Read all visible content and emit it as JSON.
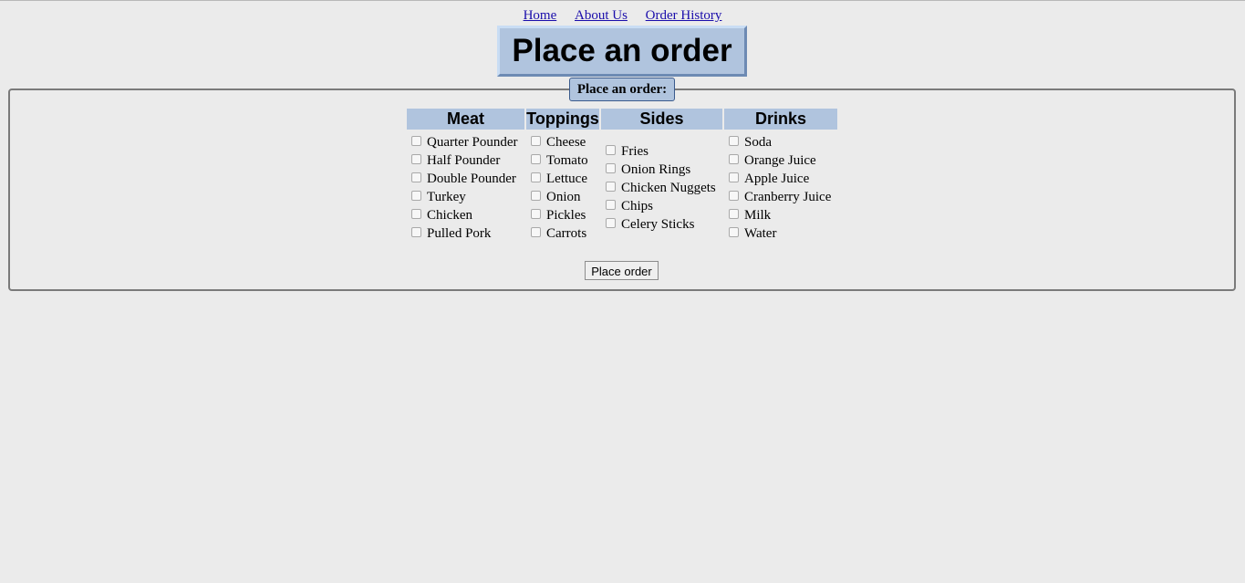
{
  "nav": {
    "links": [
      "Home",
      "About Us",
      "Order History"
    ]
  },
  "page_title": "Place an order",
  "form": {
    "legend": "Place an order:",
    "columns": [
      {
        "heading": "Meat",
        "items": [
          "Quarter Pounder",
          "Half Pounder",
          "Double Pounder",
          "Turkey",
          "Chicken",
          "Pulled Pork"
        ]
      },
      {
        "heading": "Toppings",
        "items": [
          "Cheese",
          "Tomato",
          "Lettuce",
          "Onion",
          "Pickles",
          "Carrots"
        ]
      },
      {
        "heading": "Sides",
        "items": [
          "Fries",
          "Onion Rings",
          "Chicken Nuggets",
          "Chips",
          "Celery Sticks"
        ]
      },
      {
        "heading": "Drinks",
        "items": [
          "Soda",
          "Orange Juice",
          "Apple Juice",
          "Cranberry Juice",
          "Milk",
          "Water"
        ]
      }
    ],
    "submit_label": "Place order"
  },
  "colors": {
    "page_background": "#ebebeb",
    "header_background": "#b0c4de",
    "link": "#1a0dab"
  }
}
